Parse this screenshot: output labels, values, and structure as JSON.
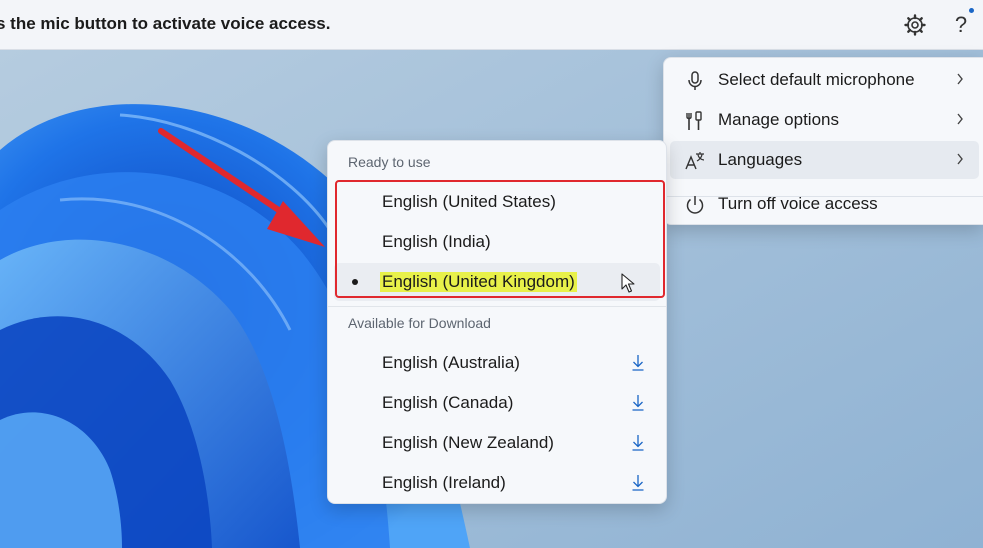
{
  "topbar": {
    "hint_text": "s the mic button to activate voice access.",
    "gear_icon": "gear-icon",
    "help_label": "?"
  },
  "main_menu": {
    "items": [
      {
        "label": "Select default microphone",
        "icon": "microphone-icon",
        "has_submenu": true
      },
      {
        "label": "Manage options",
        "icon": "tools-icon",
        "has_submenu": true
      },
      {
        "label": "Languages",
        "icon": "language-icon",
        "has_submenu": true,
        "active": true
      },
      {
        "label": "Turn off voice access",
        "icon": "power-icon",
        "has_submenu": false
      }
    ]
  },
  "languages_menu": {
    "ready_title": "Ready to use",
    "ready": [
      {
        "label": "English (United States)"
      },
      {
        "label": "English (India)"
      },
      {
        "label": "English (United Kingdom)",
        "selected": true
      }
    ],
    "download_title": "Available for Download",
    "download": [
      {
        "label": "English (Australia)"
      },
      {
        "label": "English (Canada)"
      },
      {
        "label": "English (New Zealand)"
      },
      {
        "label": "English (Ireland)"
      }
    ]
  },
  "colors": {
    "accent": "#1a66c6",
    "annotation_red": "#e0282e",
    "text_highlight": "#e8f14a"
  }
}
